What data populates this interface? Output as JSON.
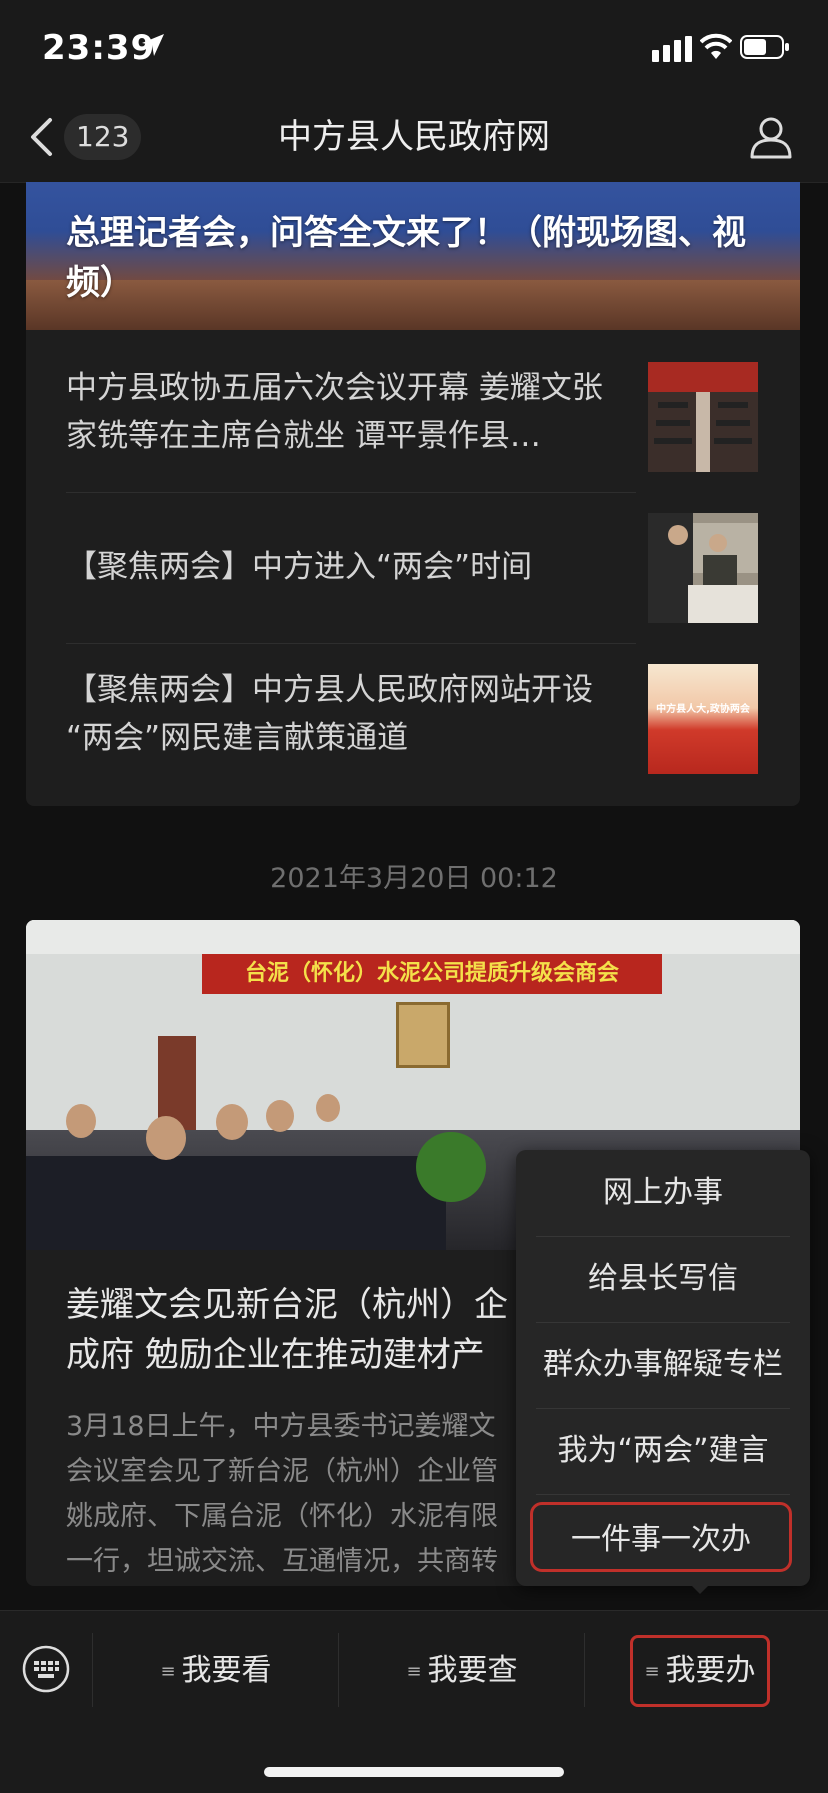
{
  "status_bar": {
    "time": "23:39"
  },
  "nav": {
    "back_count": "123",
    "title": "中方县人民政府网"
  },
  "feed": {
    "hero_title": "总理记者会，问答全文来了！（附现场图、视频）",
    "items": [
      {
        "title": "中方县政协五届六次会议开幕 姜耀文张家铣等在主席台就坐 谭平景作县…"
      },
      {
        "title": "【聚焦两会】中方进入“两会”时间"
      },
      {
        "title": "【聚焦两会】中方县人民政府网站开设 “两会”网民建言献策通道"
      }
    ],
    "thumb3_text": "中方县人大,政协两会",
    "date": "2021年3月20日 00:12",
    "article": {
      "banner": "台泥（怀化）水泥公司提质升级会商会",
      "title": "姜耀文会见新台泥（杭州）企\n成府 勉励企业在推动建材产",
      "excerpt": "3月18日上午，中方县委书记姜耀文\n会议室会见了新台泥（杭州）企业管\n姚成府、下属台泥（怀化）水泥有限\n一行，坦诚交流、互通情况，共商转"
    }
  },
  "popup_menu": {
    "items": [
      "网上办事",
      "给县长写信",
      "群众办事解疑专栏",
      "我为“两会”建言",
      "一件事一次办"
    ],
    "highlighted_index": 4
  },
  "tab_bar": {
    "tabs": [
      "我要看",
      "我要查",
      "我要办"
    ],
    "active_index": 2
  },
  "colors": {
    "highlight": "#c0302a",
    "background": "#111111"
  }
}
